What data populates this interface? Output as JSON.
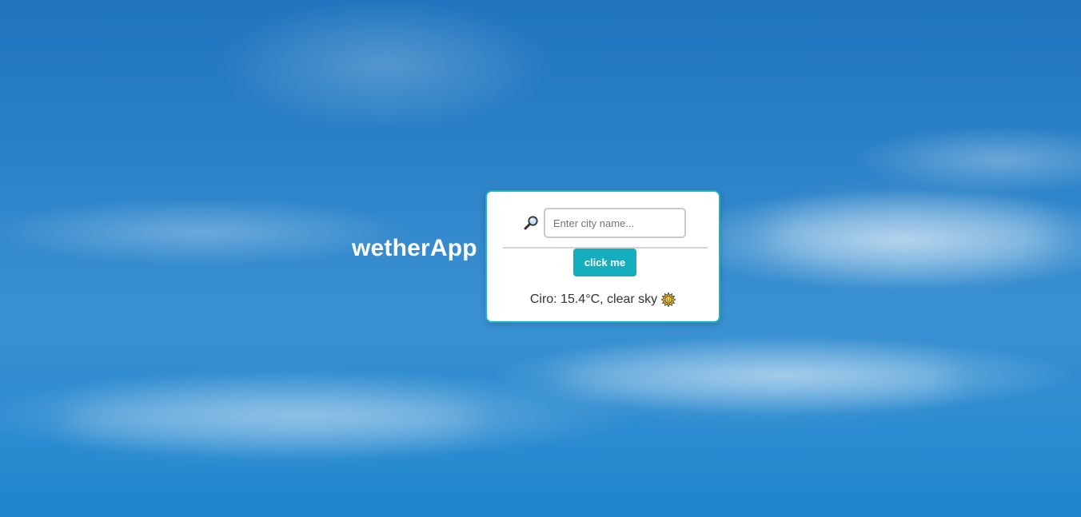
{
  "app": {
    "title": "wetherApp"
  },
  "search": {
    "placeholder": "Enter city name...",
    "value": "",
    "icon": "magnifying-glass-icon"
  },
  "button": {
    "label": "click me"
  },
  "result": {
    "text": "Ciro: 15.4°C, clear sky",
    "icon": "sun-icon"
  },
  "colors": {
    "accent": "#14aebf",
    "card_border": "#19b3c4",
    "sky": "#2e84c9"
  }
}
